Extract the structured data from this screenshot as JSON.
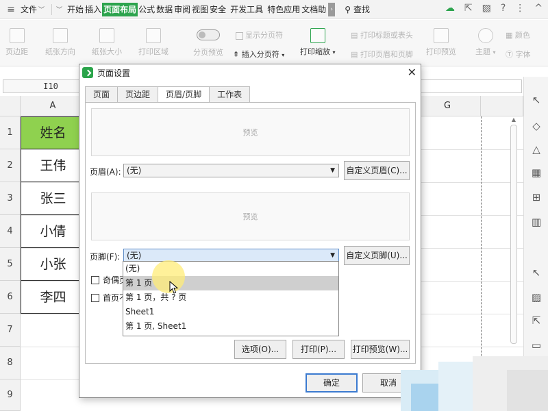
{
  "menubar": {
    "file_label": "文件",
    "items": [
      "开始",
      "插入",
      "页面布局",
      "公式",
      "数据",
      "审阅",
      "视图",
      "安全",
      "开发工具",
      "特色应用",
      "文档助"
    ],
    "active_index": 2,
    "search_label": "查找"
  },
  "ribbon": {
    "margin": "页边距",
    "orientation": "纸张方向",
    "size": "纸张大小",
    "print_area": "打印区域",
    "page_break_preview": "分页预览",
    "show_page_break": "显示分页符",
    "insert_page_break": "插入分页符",
    "print_scale": "打印缩放",
    "print_title": "打印标题或表头",
    "print_header_footer": "打印页眉和页脚",
    "print_preview": "打印预览",
    "theme": "主题",
    "colors": "颜色",
    "fonts": "字体"
  },
  "formula_bar": {
    "cell_ref": "I10"
  },
  "grid": {
    "col_a": "A",
    "col_g": "G",
    "rows": [
      "1",
      "2",
      "3",
      "4",
      "5",
      "6",
      "7",
      "8",
      "9"
    ],
    "cells": [
      "姓名",
      "王伟",
      "张三",
      "小倩",
      "小张",
      "李四"
    ],
    "header_color": "#8fd14f"
  },
  "dialog": {
    "title": "页面设置",
    "tabs": [
      "页面",
      "页边距",
      "页眉/页脚",
      "工作表"
    ],
    "active_tab": 2,
    "preview_text": "预览",
    "header_label": "页眉(A):",
    "header_value": "(无)",
    "custom_header": "自定义页眉(C)...",
    "footer_label": "页脚(F):",
    "footer_value": "(无)",
    "custom_footer": "自定义页脚(U)...",
    "odd_even_partial": "奇偶页",
    "first_page_partial": "首页不",
    "footer_options": [
      "(无)",
      "第 1 页",
      "第 1 页，共 ? 页",
      "Sheet1",
      "第 1 页, Sheet1"
    ],
    "highlighted_option": 1,
    "options_btn": "选项(O)...",
    "print_btn": "打印(P)...",
    "print_preview_btn": "打印预览(W)...",
    "ok_btn": "确定",
    "cancel_btn": "取消"
  },
  "colors": {
    "accent_green": "#2da44e",
    "selection_blue": "#3b7ad0"
  }
}
